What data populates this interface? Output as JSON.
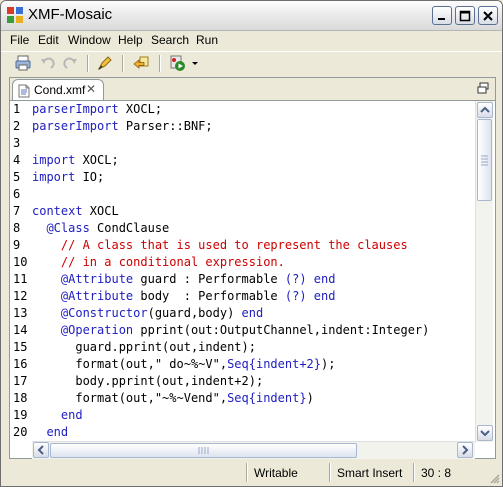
{
  "window": {
    "title": "XMF-Mosaic"
  },
  "menu": [
    "File",
    "Edit",
    "Window",
    "Help",
    "Search",
    "Run"
  ],
  "toolbar": {
    "icons": [
      "print-icon",
      "undo-icon",
      "redo-icon",
      "pen-icon",
      "back-arrow-icon",
      "run-icon",
      "dropdown-arrow-icon"
    ]
  },
  "editor": {
    "tab_label": "Cond.xmf",
    "lines": [
      {
        "n": "1",
        "segs": [
          {
            "t": "parserImport",
            "c": "kw"
          },
          {
            "t": " XOCL;",
            "c": ""
          }
        ]
      },
      {
        "n": "2",
        "segs": [
          {
            "t": "parserImport",
            "c": "kw"
          },
          {
            "t": " Parser::BNF;",
            "c": ""
          }
        ]
      },
      {
        "n": "3",
        "segs": []
      },
      {
        "n": "4",
        "segs": [
          {
            "t": "import",
            "c": "kw"
          },
          {
            "t": " XOCL;",
            "c": ""
          }
        ]
      },
      {
        "n": "5",
        "segs": [
          {
            "t": "import",
            "c": "kw"
          },
          {
            "t": " IO;",
            "c": ""
          }
        ]
      },
      {
        "n": "6",
        "segs": []
      },
      {
        "n": "7",
        "segs": [
          {
            "t": "context",
            "c": "kw"
          },
          {
            "t": " XOCL",
            "c": ""
          }
        ]
      },
      {
        "n": "8",
        "segs": [
          {
            "t": "  ",
            "c": ""
          },
          {
            "t": "@Class",
            "c": "kw"
          },
          {
            "t": " CondClause",
            "c": ""
          }
        ]
      },
      {
        "n": "9",
        "segs": [
          {
            "t": "    // A class that is used to represent the clauses",
            "c": "cm"
          }
        ]
      },
      {
        "n": "10",
        "segs": [
          {
            "t": "    // in a conditional expression.",
            "c": "cm"
          }
        ]
      },
      {
        "n": "11",
        "segs": [
          {
            "t": "    ",
            "c": ""
          },
          {
            "t": "@Attribute",
            "c": "kw"
          },
          {
            "t": " guard : Performable ",
            "c": ""
          },
          {
            "t": "(?)",
            "c": "kw"
          },
          {
            "t": " ",
            "c": ""
          },
          {
            "t": "end",
            "c": "kw"
          }
        ]
      },
      {
        "n": "12",
        "segs": [
          {
            "t": "    ",
            "c": ""
          },
          {
            "t": "@Attribute",
            "c": "kw"
          },
          {
            "t": " body  : Performable ",
            "c": ""
          },
          {
            "t": "(?)",
            "c": "kw"
          },
          {
            "t": " ",
            "c": ""
          },
          {
            "t": "end",
            "c": "kw"
          }
        ]
      },
      {
        "n": "13",
        "segs": [
          {
            "t": "    ",
            "c": ""
          },
          {
            "t": "@Constructor",
            "c": "kw"
          },
          {
            "t": "(guard,body) ",
            "c": ""
          },
          {
            "t": "end",
            "c": "kw"
          }
        ]
      },
      {
        "n": "14",
        "segs": [
          {
            "t": "    ",
            "c": ""
          },
          {
            "t": "@Operation",
            "c": "kw"
          },
          {
            "t": " pprint(out:OutputChannel,indent:Integer)",
            "c": ""
          }
        ]
      },
      {
        "n": "15",
        "segs": [
          {
            "t": "      guard.pprint(out,indent);",
            "c": ""
          }
        ]
      },
      {
        "n": "16",
        "segs": [
          {
            "t": "      format(out,\" do~%~V\",",
            "c": ""
          },
          {
            "t": "Seq{indent+2}",
            "c": "kw"
          },
          {
            "t": ");",
            "c": ""
          }
        ]
      },
      {
        "n": "17",
        "segs": [
          {
            "t": "      body.pprint(out,indent+2);",
            "c": ""
          }
        ]
      },
      {
        "n": "18",
        "segs": [
          {
            "t": "      format(out,\"~%~Vend\",",
            "c": ""
          },
          {
            "t": "Seq{indent}",
            "c": "kw"
          },
          {
            "t": ")",
            "c": ""
          }
        ]
      },
      {
        "n": "19",
        "segs": [
          {
            "t": "    ",
            "c": ""
          },
          {
            "t": "end",
            "c": "kw"
          }
        ]
      },
      {
        "n": "20",
        "segs": [
          {
            "t": "  ",
            "c": ""
          },
          {
            "t": "end",
            "c": "kw"
          }
        ]
      }
    ]
  },
  "status": {
    "mode": "Writable",
    "insert": "Smart Insert",
    "position": "30 : 8"
  },
  "colors": {
    "keyword": "#2020c0",
    "comment": "#cc0000",
    "background": "#ece9d8"
  }
}
